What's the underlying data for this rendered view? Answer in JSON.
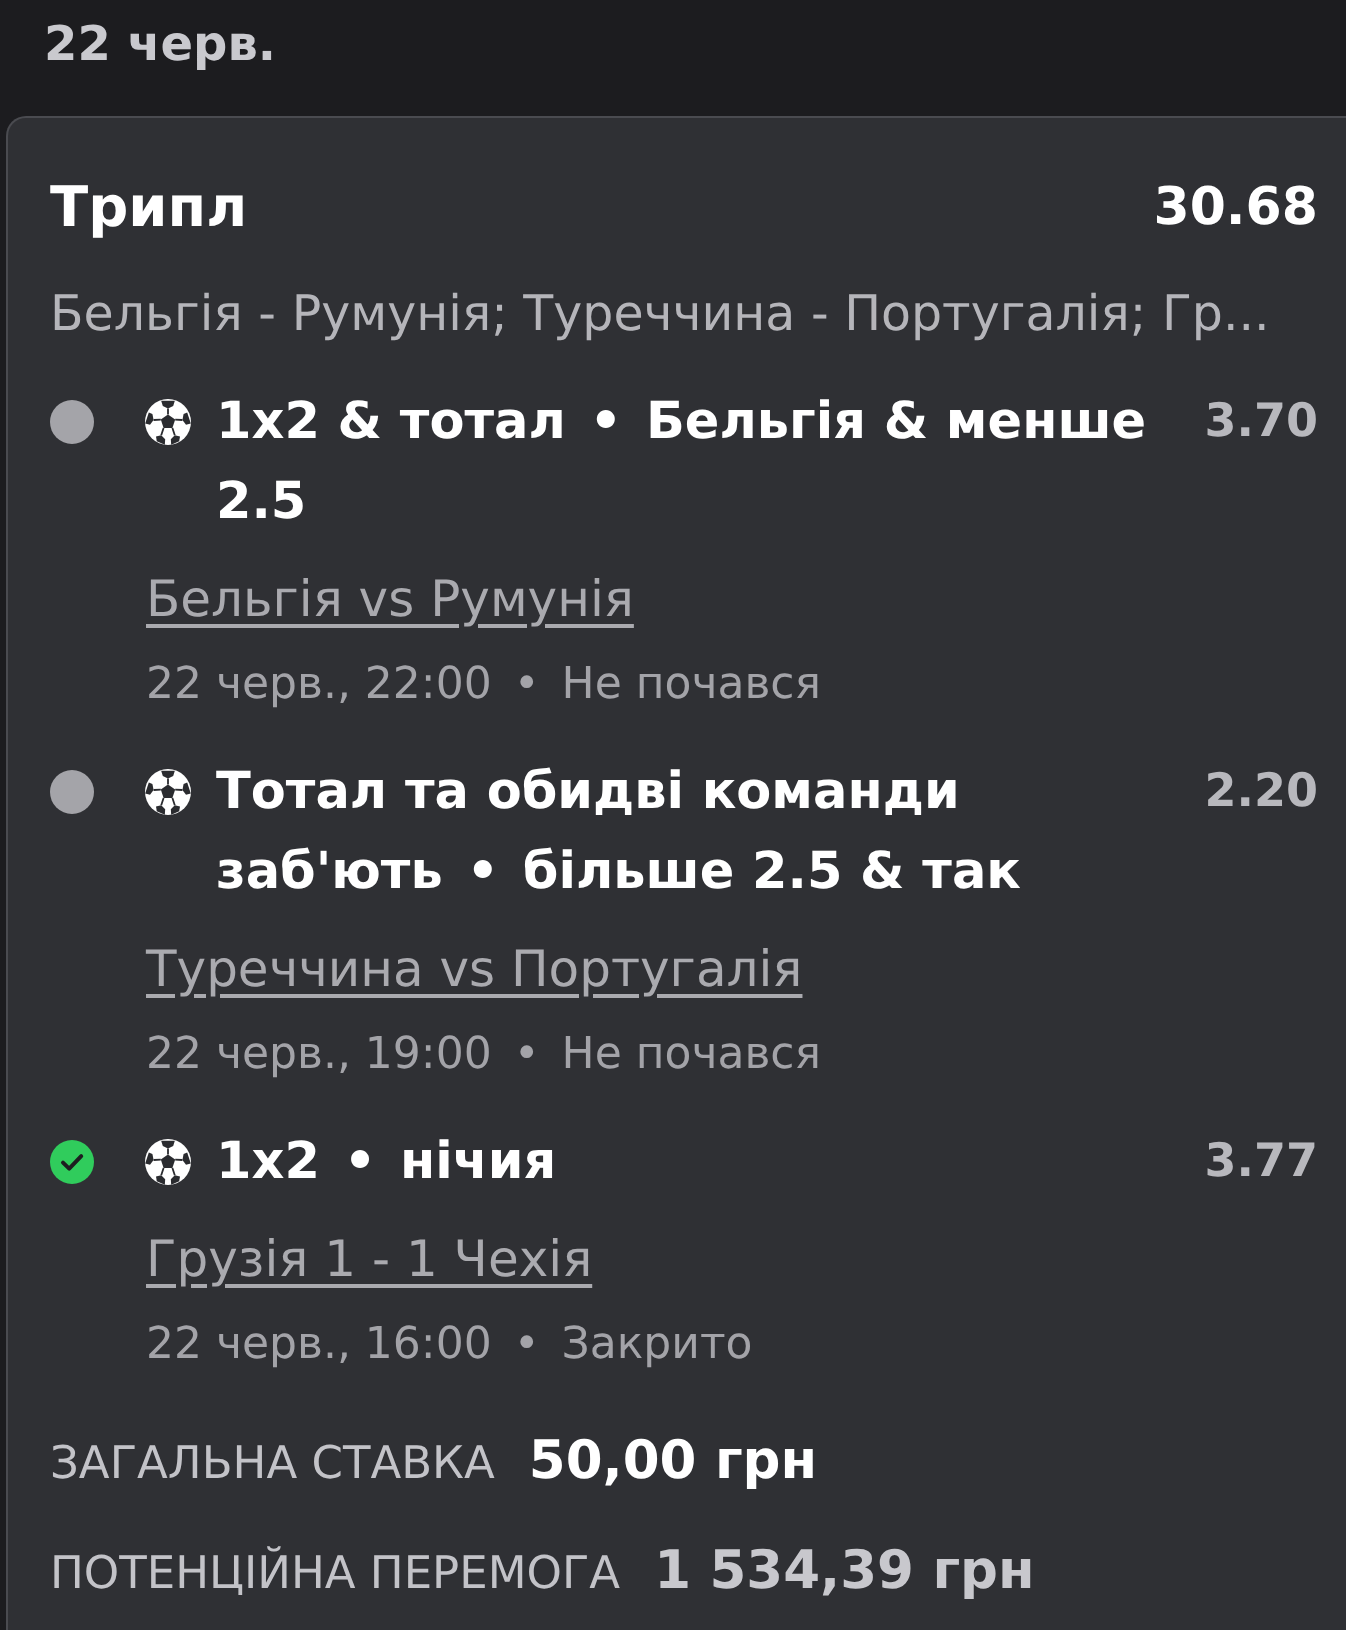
{
  "header": {
    "date": "22 черв."
  },
  "bet": {
    "type": "Трипл",
    "total_odds": "30.68",
    "events_summary": "Бельгія - Румунія; Туреччина - Португалія; Гр...",
    "legs": [
      {
        "won": false,
        "market": "1x2 & тотал",
        "dot": "•",
        "selection": "Бельгія & менше 2.5",
        "odds": "3.70",
        "match": "Бельгія vs Румунія",
        "datetime": "22 черв., 22:00",
        "meta_dot": "•",
        "status": "Не почався"
      },
      {
        "won": false,
        "market": "Тотал та обидві команди заб'ють",
        "dot": "•",
        "selection": "більше 2.5 & так",
        "odds": "2.20",
        "match": "Туреччина vs Португалія",
        "datetime": "22 черв., 19:00",
        "meta_dot": "•",
        "status": "Не почався"
      },
      {
        "won": true,
        "market": "1x2",
        "dot": "•",
        "selection": "нічия",
        "odds": "3.77",
        "match": "Грузія 1 - 1 Чехія",
        "datetime": "22 черв., 16:00",
        "meta_dot": "•",
        "status": "Закрито"
      }
    ],
    "stake": {
      "label": "ЗАГАЛЬНА СТАВКА",
      "value": "50,00 грн"
    },
    "potential_win": {
      "label": "ПОТЕНЦІЙНА ПЕРЕМОГА",
      "value": "1 534,39 грн"
    }
  }
}
